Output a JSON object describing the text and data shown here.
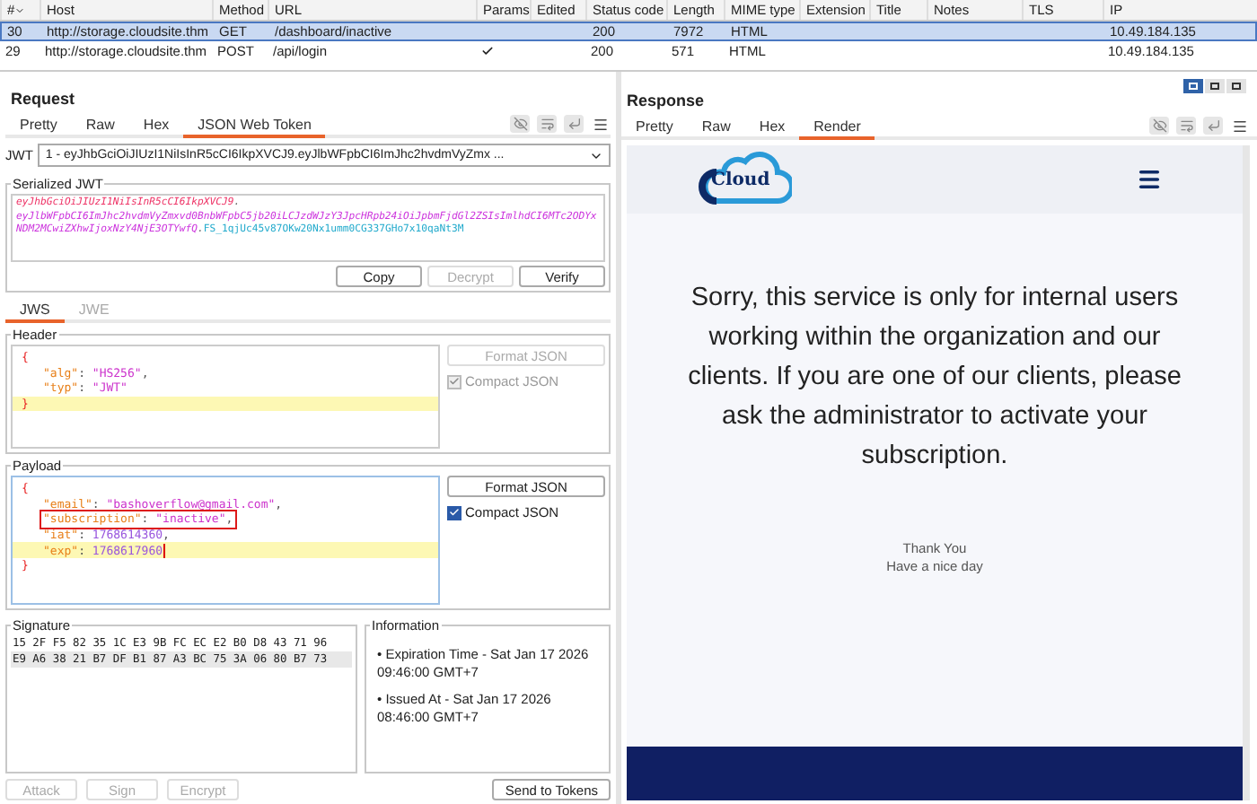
{
  "table": {
    "columns": [
      "#",
      "Host",
      "Method",
      "URL",
      "Params",
      "Edited",
      "Status code",
      "Length",
      "MIME type",
      "Extension",
      "Title",
      "Notes",
      "TLS",
      "IP"
    ],
    "rows": [
      {
        "selected": true,
        "id": "30",
        "host": "http://storage.cloudsite.thm",
        "method": "GET",
        "url": "/dashboard/inactive",
        "params": false,
        "status": "200",
        "length": "7972",
        "mime": "HTML",
        "ip": "10.49.184.135"
      },
      {
        "selected": false,
        "id": "29",
        "host": "http://storage.cloudsite.thm",
        "method": "POST",
        "url": "/api/login",
        "params": true,
        "status": "200",
        "length": "571",
        "mime": "HTML",
        "ip": "10.49.184.135"
      }
    ]
  },
  "request": {
    "title": "Request",
    "tabs": [
      {
        "label": "Pretty",
        "selected": false
      },
      {
        "label": "Raw",
        "selected": false
      },
      {
        "label": "Hex",
        "selected": false
      },
      {
        "label": "JSON Web Token",
        "selected": true
      }
    ],
    "jwt_label": "JWT",
    "jwt_select": "1 - eyJhbGciOiJIUzI1NiIsInR5cCI6IkpXVCJ9.eyJlbWFpbCI6ImJhc2hvdmVyZmx ...",
    "serialized": {
      "legend": "Serialized JWT",
      "lines": [
        [
          {
            "kind": "header",
            "text": "eyJhbGciOiJIUzI1NiIsInR5cCI6IkpXVCJ9"
          },
          {
            "kind": "dot",
            "text": "."
          }
        ],
        [
          {
            "kind": "payload",
            "text": "eyJlbWFpbCI6ImJhc2hvdmVyZmxvd0BnbWFpbC5jb20iLCJzdWJzY3JpcHRpb24iOiJpbmFjdGl2ZSIsImlhdCI6MTc2ODYxNDM2MCwiZXhwIjoxNzY4NjE3OTYwfQ"
          },
          {
            "kind": "dot",
            "text": "."
          },
          {
            "kind": "signature",
            "text": "FS_1qjUc45v87OKw20Nx1umm0CG337GHo7x10qaNt3M"
          }
        ]
      ],
      "buttons": [
        {
          "label": "Copy",
          "disabled": false
        },
        {
          "label": "Decrypt",
          "disabled": true
        },
        {
          "label": "Verify",
          "disabled": false
        }
      ]
    },
    "sub_tabs": [
      {
        "label": "JWS",
        "selected": true
      },
      {
        "label": "JWE",
        "selected": false
      }
    ],
    "editors": [
      {
        "legend": "Header",
        "format_button": {
          "label": "Format JSON",
          "disabled": true
        },
        "compact": {
          "label": "Compact JSON",
          "checked": true,
          "disabled": true
        },
        "lines": [
          {
            "highlighted": false,
            "boxed": false,
            "cursor": false,
            "tokens": [
              {
                "kind": "brace",
                "text": "{"
              }
            ]
          },
          {
            "highlighted": false,
            "boxed": false,
            "cursor": false,
            "tokens": [
              {
                "kind": "key",
                "text": "\"alg\""
              },
              {
                "kind": "punct",
                "text": ": "
              },
              {
                "kind": "string",
                "text": "\"HS256\""
              },
              {
                "kind": "punct",
                "text": ","
              }
            ]
          },
          {
            "highlighted": false,
            "boxed": false,
            "cursor": false,
            "tokens": [
              {
                "kind": "key",
                "text": "\"typ\""
              },
              {
                "kind": "punct",
                "text": ": "
              },
              {
                "kind": "string",
                "text": "\"JWT\""
              }
            ]
          },
          {
            "highlighted": true,
            "boxed": false,
            "cursor": false,
            "tokens": [
              {
                "kind": "brace",
                "text": "}"
              }
            ]
          }
        ]
      },
      {
        "legend": "Payload",
        "format_button": {
          "label": "Format JSON",
          "disabled": false
        },
        "compact": {
          "label": "Compact JSON",
          "checked": true,
          "disabled": false
        },
        "lines": [
          {
            "highlighted": false,
            "boxed": false,
            "cursor": false,
            "tokens": [
              {
                "kind": "brace",
                "text": "{"
              }
            ]
          },
          {
            "highlighted": false,
            "boxed": false,
            "cursor": false,
            "tokens": [
              {
                "kind": "key",
                "text": "\"email\""
              },
              {
                "kind": "punct",
                "text": ": "
              },
              {
                "kind": "string",
                "text": "\"bashoverflow@gmail.com\""
              },
              {
                "kind": "punct",
                "text": ","
              }
            ]
          },
          {
            "highlighted": false,
            "boxed": true,
            "cursor": false,
            "tokens": [
              {
                "kind": "key",
                "text": "\"subscription\""
              },
              {
                "kind": "punct",
                "text": ": "
              },
              {
                "kind": "string",
                "text": "\"inactive\""
              },
              {
                "kind": "punct",
                "text": ","
              }
            ]
          },
          {
            "highlighted": false,
            "boxed": false,
            "cursor": false,
            "tokens": [
              {
                "kind": "key",
                "text": "\"iat\""
              },
              {
                "kind": "punct",
                "text": ": "
              },
              {
                "kind": "number",
                "text": "1768614360"
              },
              {
                "kind": "punct",
                "text": ","
              }
            ]
          },
          {
            "highlighted": true,
            "boxed": false,
            "cursor": true,
            "tokens": [
              {
                "kind": "key",
                "text": "\"exp\""
              },
              {
                "kind": "punct",
                "text": ": "
              },
              {
                "kind": "number",
                "text": "1768617960"
              }
            ]
          },
          {
            "highlighted": false,
            "boxed": false,
            "cursor": false,
            "tokens": [
              {
                "kind": "brace",
                "text": "}"
              }
            ]
          }
        ]
      }
    ],
    "signature": {
      "legend": "Signature",
      "rows": [
        {
          "selected": false,
          "bytes": "15 2F F5 82 35 1C E3 9B FC EC E2 B0 D8 43 71 96"
        },
        {
          "selected": true,
          "bytes": "E9 A6 38 21 B7 DF B1 87 A3 BC 75 3A 06 80 B7 73"
        }
      ]
    },
    "information": {
      "legend": "Information",
      "items": [
        "• Expiration Time - Sat Jan 17 2026 09:46:00 GMT+7",
        "• Issued At - Sat Jan 17 2026 08:46:00 GMT+7"
      ]
    },
    "actions": [
      {
        "label": "Attack",
        "disabled": true
      },
      {
        "label": "Sign",
        "disabled": true
      },
      {
        "label": "Encrypt",
        "disabled": true
      }
    ],
    "send_button": {
      "label": "Send to Tokens",
      "disabled": false
    }
  },
  "response": {
    "title": "Response",
    "layout_toggle": [
      {
        "selected": true
      },
      {
        "selected": false
      },
      {
        "selected": false
      }
    ],
    "tabs": [
      {
        "label": "Pretty",
        "selected": false
      },
      {
        "label": "Raw",
        "selected": false
      },
      {
        "label": "Hex",
        "selected": false
      },
      {
        "label": "Render",
        "selected": true
      }
    ],
    "render": {
      "logo_text": "Cloud",
      "message": "Sorry, this service is only for internal users working within the organization and our clients. If you are one of our clients, please ask the administrator to activate your subscription.",
      "thanks": [
        "Thank You",
        "Have a nice day"
      ]
    }
  }
}
